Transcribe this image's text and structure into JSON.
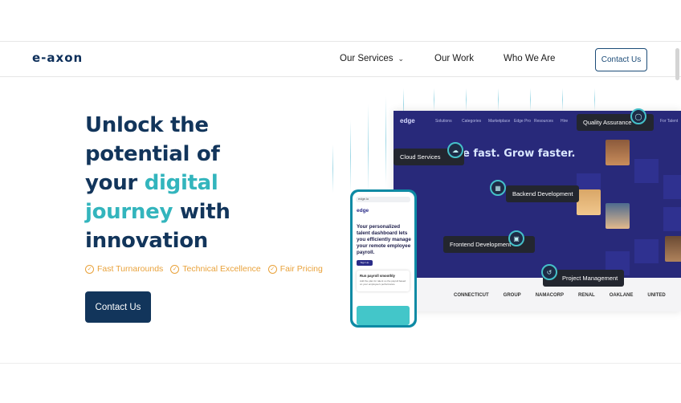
{
  "nav": {
    "logo": "e-axon",
    "items": [
      "Our Services",
      "Our Work",
      "Who We Are"
    ],
    "contact_button": "Contact Us"
  },
  "hero": {
    "title_line1": "Unlock the",
    "title_line2": "potential of",
    "title_line3_a": "your ",
    "title_line3_b": "digital",
    "title_line4_a": "journey",
    "title_line4_b": " with",
    "title_line5": "innovation",
    "features": [
      "Fast Turnarounds",
      "Technical Excellence",
      "Fair Pricing"
    ],
    "cta": "Contact Us"
  },
  "illustration": {
    "dashboard_logo": "edge",
    "dashboard_menu": [
      "Solutions",
      "Categories",
      "Marketplace",
      "Edge Pro",
      "Resources",
      "Hire",
      "For Talent"
    ],
    "dashboard_headline": "e fast. Grow faster.",
    "tags": [
      "Quality Assurance",
      "Cloud Services",
      "Backend Development",
      "Frontend Development",
      "Project Management"
    ],
    "client_logos": [
      "CONNECTICUT",
      "GROUP",
      "NAMACORP",
      "RENAL",
      "OAKLANE",
      "UNITED"
    ],
    "phone": {
      "url": "edge.io",
      "logo": "edge",
      "headline": "Your personalized talent dashboard lets you efficiently manage your remote employee payroll.",
      "button": "Sign Up",
      "card_title": "Run payroll smoothly",
      "card_text": "Add the plan for talent so the payroll based on your employee's performance"
    }
  },
  "colors": {
    "navy": "#12355b",
    "teal": "#33b5bd",
    "orange": "#e9a23b",
    "dashboard_bg": "#28297a"
  }
}
